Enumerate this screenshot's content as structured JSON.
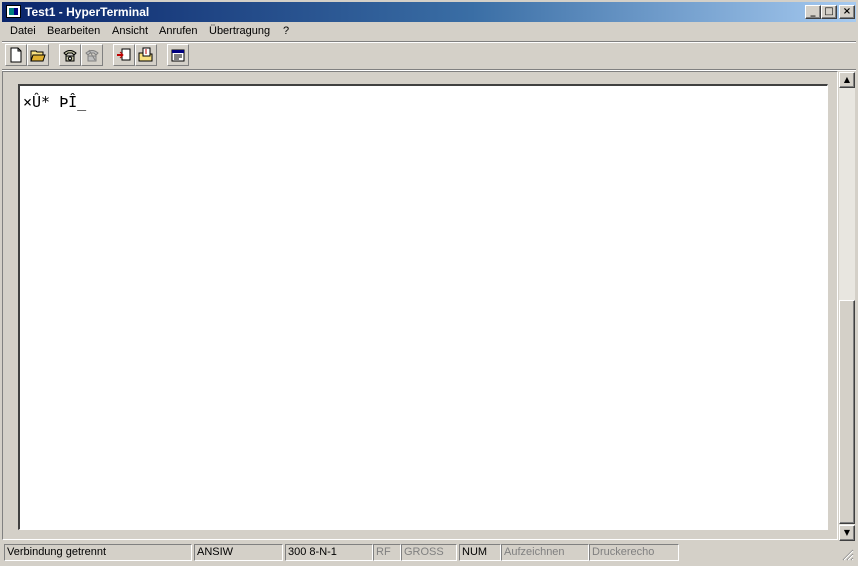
{
  "window": {
    "title": "Test1 - HyperTerminal"
  },
  "caption_buttons": {
    "minimize": "_",
    "maximize": "□",
    "close": "×"
  },
  "menu": [
    "Datei",
    "Bearbeiten",
    "Ansicht",
    "Anrufen",
    "Übertragung",
    "?"
  ],
  "toolbar_icons": [
    "new-document-icon",
    "open-folder-icon",
    "call-phone-icon",
    "disconnect-phone-icon",
    "send-file-icon",
    "receive-file-icon",
    "properties-icon"
  ],
  "terminal": {
    "text": "×Û* ÞÎ_"
  },
  "status": {
    "connection": "Verbindung getrennt",
    "emulation": "ANSIW",
    "settings": "300 8-N-1",
    "scroll": "RF",
    "caps": "GROSS",
    "num": "NUM",
    "capture": "Aufzeichnen",
    "print_echo": "Druckerecho"
  }
}
